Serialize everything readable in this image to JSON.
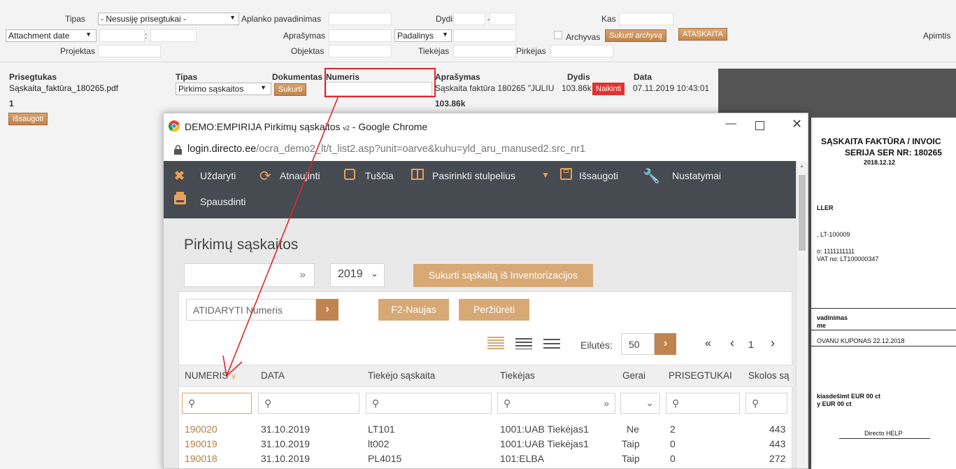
{
  "filters": {
    "tipas_label": "Tipas",
    "tipas_value": "- Nesusiję prisegtukai -",
    "aplanko_label": "Aplanko pavadinimas",
    "dydis_label": "Dydis",
    "dydis_sep": "-",
    "kas_label": "Kas",
    "date_select": "Attachment date",
    "date_colon": ":",
    "aprasymas_label": "Aprašymas",
    "padalinys_select": "Padalinys",
    "archyvas_label": "Archyvas",
    "sukurti_archyva_btn": "Sukurti archyvą",
    "ataskaita_btn": "ATASKAITA",
    "apimtis_label": "Apimtis",
    "projektas_label": "Projektas",
    "objektas_label": "Objektas",
    "tiekejas_label": "Tiekėjas",
    "pirkejas_label": "Pirkėjas"
  },
  "attachments": {
    "headers": {
      "prisegtukas": "Prisegtukas",
      "tipas": "Tipas",
      "dokumentas": "Dokumentas",
      "numeris": "Numeris",
      "aprasymas": "Aprašymas",
      "dydis": "Dydis",
      "data": "Data"
    },
    "row": {
      "file": "Sąskaita_faktūra_180265.pdf",
      "type": "Pirkimo sąskaitos",
      "sukurti": "Sukurti",
      "description": "Sąskaita faktūra 180265 \"JULIU",
      "size": "103.86k",
      "naikinti": "Naikinti",
      "date": "07.11.2019 10:43:01"
    },
    "count": "1",
    "total": "103.86k",
    "save_btn": "Išsaugoti"
  },
  "preview": {
    "title1": "SĄSKAITA FAKTŪRA / INVOIC",
    "title2": "SERIJA SER NR: 180265",
    "date": "2018.12.12",
    "seller": "LLER",
    "code": ", LT-100009",
    "no": "o: 1111111111",
    "vat": "VAT no: LT100000347",
    "pav1": "vadinimas",
    "pav2": "me",
    "item": "OVANU KUPONAS 22.12.2018",
    "sum1": "kiasdešimt  EUR  00 ct",
    "sum2": "y  EUR  00 ct",
    "help": "Directo HELP"
  },
  "window": {
    "title": "DEMO:EMPIRIJA Pirkimų sąskaitos",
    "title_suffix": "v2",
    "title_app": " - Google Chrome",
    "url_host": "login.directo.ee",
    "url_path": "/ocra_demo2_lt/t_list2.asp?unit=oarve&kuhu=yld_aru_manused2.src_nr1"
  },
  "toolbar": {
    "close": "Uždaryti",
    "refresh": "Atnaujinti",
    "empty": "Tuščia",
    "columns": "Pasirinkti stulpelius",
    "save": "Išsaugoti",
    "settings": "Nustatymai",
    "print": "Spausdinti"
  },
  "page": {
    "title": "Pirkimų sąskaitos",
    "range_arrow": "»",
    "year": "2019",
    "create_inventory_btn": "Sukurti sąskaitą iš Inventorizacijos",
    "open_placeholder": "ATIDARYTI Numeris",
    "f2_btn": "F2-Naujas",
    "view_btn": "Peržiūrėti",
    "rows_label": "Eilutės:",
    "rows_value": "50",
    "page_first": "«",
    "page_prev": "‹",
    "page_num": "1",
    "page_next": "›"
  },
  "table": {
    "columns": [
      "NUMERIS",
      "DATA",
      "Tiekėjo sąskaita",
      "Tiekėjas",
      "Gerai",
      "PRISEGTUKAI",
      "Skolos są"
    ],
    "rows": [
      [
        "190020",
        "31.10.2019",
        "LT101",
        "1001:UAB Tiekėjas1",
        "Ne",
        "2",
        "443"
      ],
      [
        "190019",
        "31.10.2019",
        "lt002",
        "1001:UAB Tiekėjas1",
        "Taip",
        "0",
        "443"
      ],
      [
        "190018",
        "31.10.2019",
        "PL4015",
        "101:ELBA",
        "Taip",
        "0",
        "272"
      ]
    ]
  },
  "colors": {
    "accent": "#c08450",
    "toolbar": "#464a51",
    "annotation": "#e0262a"
  }
}
